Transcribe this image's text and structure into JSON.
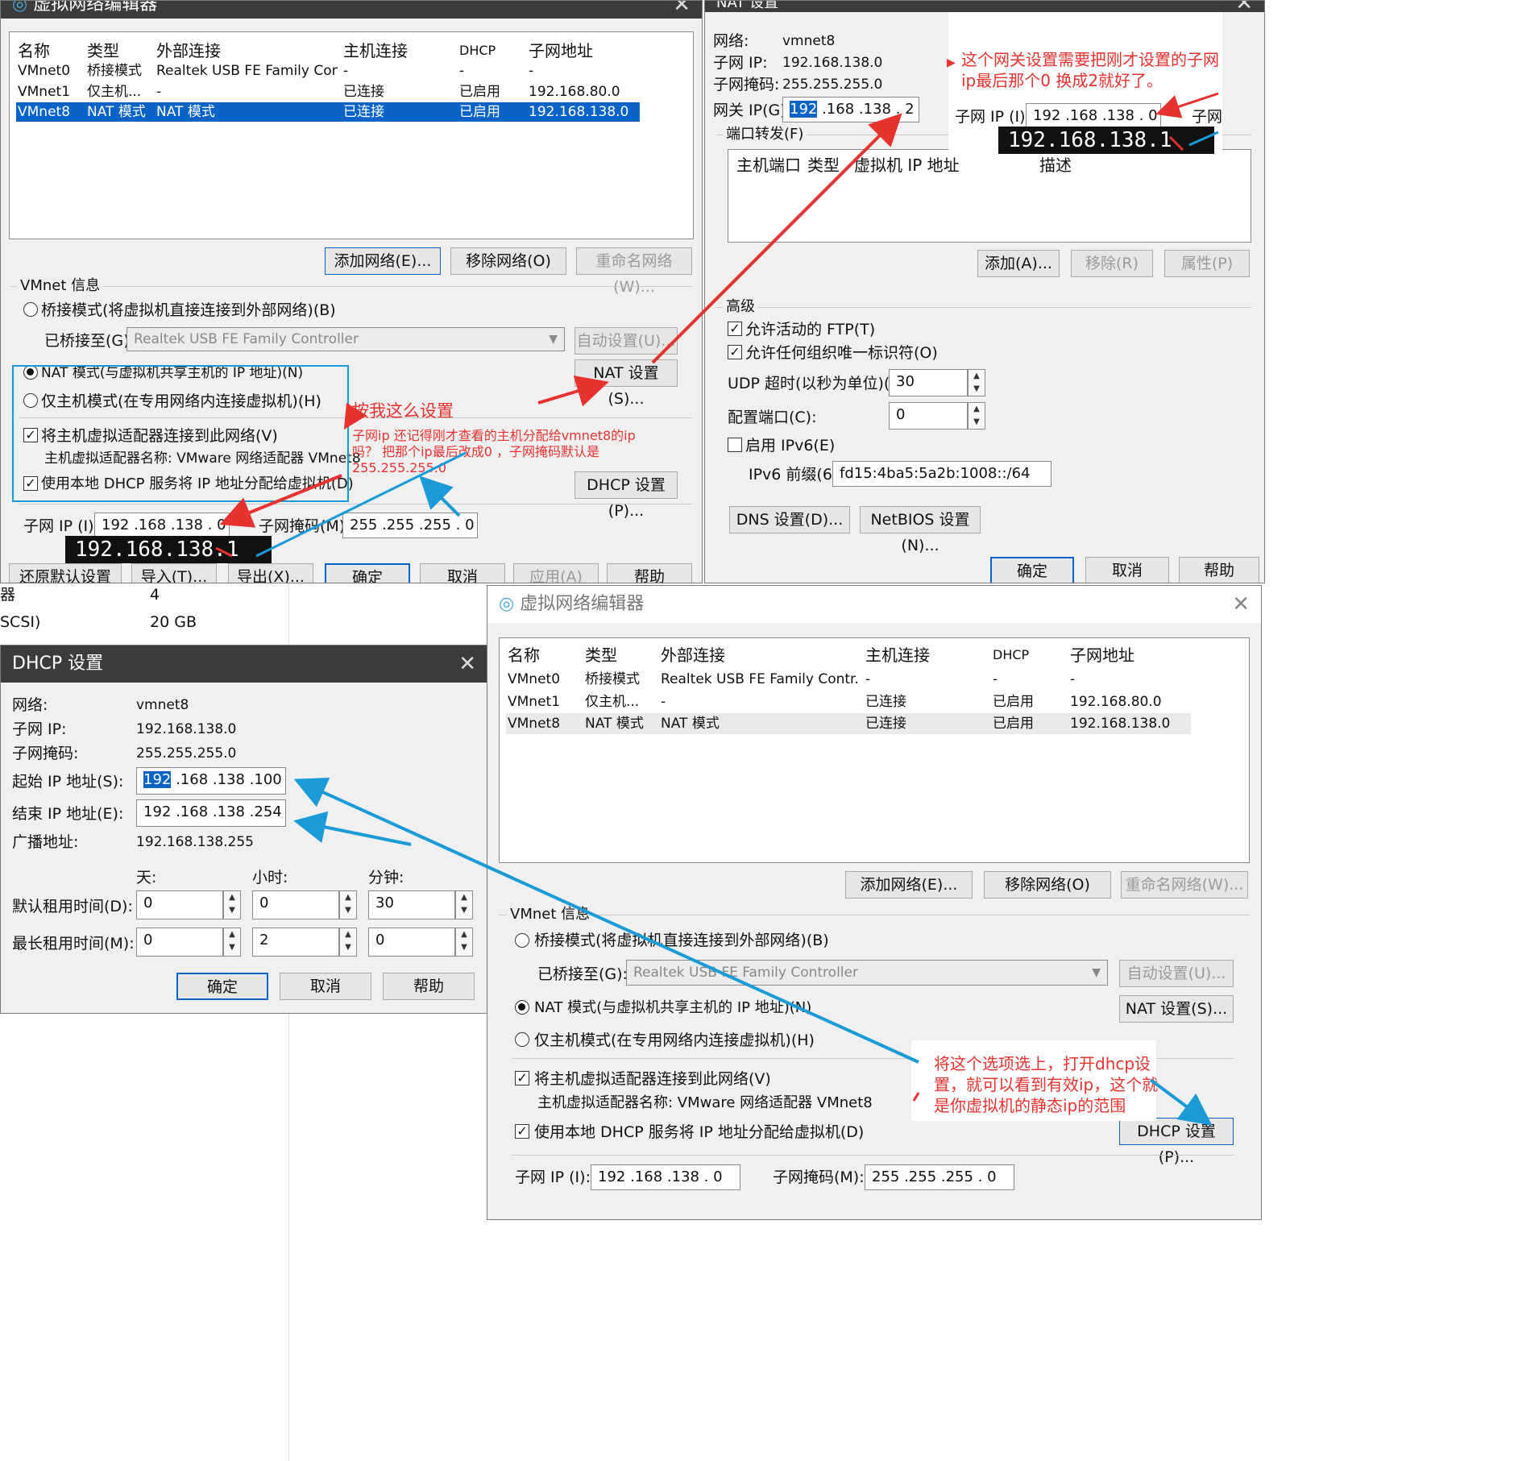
{
  "columns": [
    "名称",
    "类型",
    "外部连接",
    "主机连接",
    "DHCP",
    "子网地址"
  ],
  "networks": [
    {
      "name": "VMnet0",
      "type": "桥接模式",
      "external": "Realtek USB FE Family Contr...",
      "host": "-",
      "dhcp": "-",
      "subnet": "-"
    },
    {
      "name": "VMnet1",
      "type": "仅主机...",
      "external": "-",
      "host": "已连接",
      "dhcp": "已启用",
      "subnet": "192.168.80.0"
    },
    {
      "name": "VMnet8",
      "type": "NAT 模式",
      "external": "NAT 模式",
      "host": "已连接",
      "dhcp": "已启用",
      "subnet": "192.168.138.0"
    }
  ],
  "vne": {
    "title": "虚拟网络编辑器",
    "add_network": "添加网络(E)...",
    "remove_network": "移除网络(O)",
    "rename_network": "重命名网络(W)...",
    "vmnet_info": "VMnet 信息",
    "bridge_mode": "桥接模式(将虚拟机直接连接到外部网络)(B)",
    "bridged_to_label": "已桥接至(G):",
    "bridged_to_value": "Realtek USB FE Family Controller",
    "auto_settings": "自动设置(U)...",
    "nat_mode": "NAT 模式(与虚拟机共享主机的 IP 地址)(N)",
    "nat_settings": "NAT 设置(S)...",
    "hostonly_mode": "仅主机模式(在专用网络内连接虚拟机)(H)",
    "connect_host_adapter": "将主机虚拟适配器连接到此网络(V)",
    "host_adapter_name": "主机虚拟适配器名称: VMware 网络适配器 VMnet8",
    "use_dhcp": "使用本地 DHCP 服务将 IP 地址分配给虚拟机(D)",
    "dhcp_settings": "DHCP 设置(P)...",
    "subnet_ip_label": "子网 IP (I):",
    "subnet_ip": "192 .168 .138 .  0",
    "subnet_mask_label": "子网掩码(M):",
    "subnet_mask": "255 .255 .255 .  0",
    "restore_defaults": "还原默认设置(R)",
    "import": "导入(T)...",
    "export": "导出(X)...",
    "ok": "确定",
    "cancel": "取消",
    "apply": "应用(A)",
    "help": "帮助"
  },
  "nat": {
    "title": "NAT 设置",
    "network_label": "网络:",
    "network_value": "vmnet8",
    "subnet_ip_label": "子网 IP:",
    "subnet_ip_value": "192.168.138.0",
    "subnet_mask_label": "子网掩码:",
    "subnet_mask_value": "255.255.255.0",
    "gateway_label": "网关 IP(G):",
    "gateway_sel": "192",
    "gateway_rest": " .168 .138 .  2",
    "port_forward": "端口转发(F)",
    "pf_columns": [
      "主机端口",
      "类型",
      "虚拟机 IP 地址",
      "描述"
    ],
    "add": "添加(A)...",
    "remove": "移除(R)",
    "properties": "属性(P)",
    "advanced": "高级",
    "allow_ftp": "允许活动的 FTP(T)",
    "allow_oui": "允许任何组织唯一标识符(O)",
    "udp_label": "UDP 超时(以秒为单位)(U):",
    "udp_value": "30",
    "config_port_label": "配置端口(C):",
    "config_port_value": "0",
    "enable_ipv6": "启用 IPv6(E)",
    "ipv6_prefix_label": "IPv6 前缀(6):",
    "ipv6_prefix_value": "fd15:4ba5:5a2b:1008::/64",
    "dns": "DNS 设置(D)...",
    "netbios": "NetBIOS 设置(N)...",
    "ok": "确定",
    "cancel": "取消",
    "help": "帮助"
  },
  "dhcp": {
    "title": "DHCP 设置",
    "network_label": "网络:",
    "network_value": "vmnet8",
    "subnet_ip_label": "子网 IP:",
    "subnet_ip_value": "192.168.138.0",
    "subnet_mask_label": "子网掩码:",
    "subnet_mask_value": "255.255.255.0",
    "start_label": "起始 IP 地址(S):",
    "start_sel": "192",
    "start_rest": " .168 .138 .100",
    "end_label": "结束 IP 地址(E):",
    "end_value": "192 .168 .138 .254",
    "broadcast_label": "广播地址:",
    "broadcast_value": "192.168.138.255",
    "days": "天:",
    "hours": "小时:",
    "minutes": "分钟:",
    "default_lease_label": "默认租用时间(D):",
    "default_lease": [
      "0",
      "0",
      "30"
    ],
    "max_lease_label": "最长租用时间(M):",
    "max_lease": [
      "0",
      "2",
      "0"
    ],
    "ok": "确定",
    "cancel": "取消",
    "help": "帮助"
  },
  "background": {
    "row1_label": "器",
    "row1_value": "4",
    "row2_label": "SCSI)",
    "row2_value": "20 GB"
  },
  "snippet": {
    "subnet_ip_label": "子网 IP (I):",
    "subnet_ip": "192 .168 .138 .  0",
    "subnet_mask_label": "子网"
  },
  "annotations": {
    "set_like_me": "按我这么设置",
    "subnet_note_1": "子网ip  还记得刚才查看的主机分配给vmnet8的ip",
    "subnet_note_2": "吗？ 把那个ip最后改成0 ，子网掩码默认是",
    "subnet_note_3": "255.255.255.0",
    "gateway_note_1": "这个网关设置需要把刚才设置的子网",
    "gateway_note_2": "ip最后那个0 换成2就好了。",
    "dhcp_note_1": "将这个选项选上，打开dhcp设",
    "dhcp_note_2": "置，就可以看到有效ip，这个就",
    "dhcp_note_3": "是你虚拟机的静态ip的范围",
    "host_ip_1": "192.168.138.1",
    "host_ip_2": "192.168.138.1"
  },
  "colors": {
    "annotation_red": "#e8322f",
    "annotation_blue": "#1a9ad6",
    "selection_blue": "#0a64c8",
    "titlebar_dark": "#3c3c3c"
  }
}
